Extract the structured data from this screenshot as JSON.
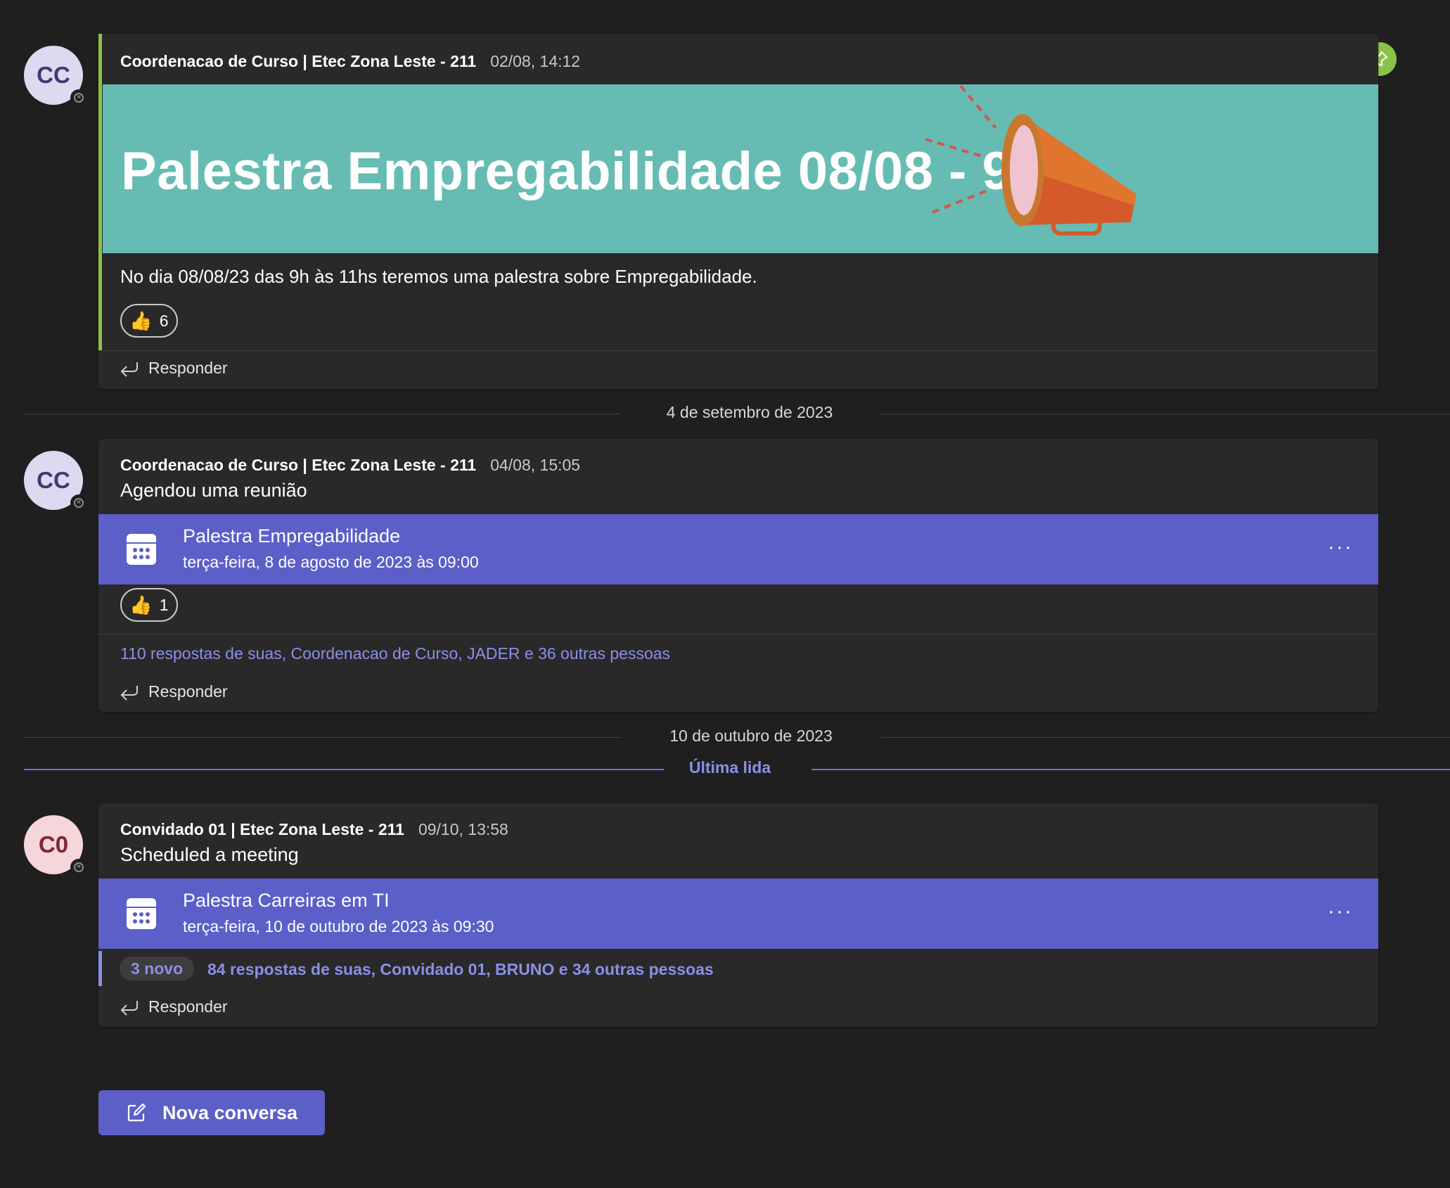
{
  "posts": [
    {
      "avatar_initials": "CC",
      "author": "Coordenacao de Curso | Etec Zona Leste - 211",
      "time": "02/08, 14:12",
      "banner_title": "Palestra Empregabilidade 08/08 - 9h",
      "body": "No dia 08/08/23 das 9h às 11hs teremos uma palestra sobre Empregabilidade.",
      "reaction_count": "6",
      "reply_label": "Responder"
    },
    {
      "avatar_initials": "CC",
      "author": "Coordenacao de Curso | Etec Zona Leste - 211",
      "time": "04/08, 15:05",
      "subject": "Agendou uma reunião",
      "meeting_title": "Palestra Empregabilidade",
      "meeting_date": "terça-feira, 8 de agosto de 2023 às 09:00",
      "reaction_count": "1",
      "replies_summary": "110 respostas de suas, Coordenacao de Curso, JADER e 36 outras pessoas",
      "reply_label": "Responder"
    },
    {
      "avatar_initials": "C0",
      "author": "Convidado 01 | Etec Zona Leste - 211",
      "time": "09/10, 13:58",
      "subject": "Scheduled a meeting",
      "meeting_title": "Palestra Carreiras em TI",
      "meeting_date": "terça-feira, 10 de outubro de 2023 às 09:30",
      "new_badge": "3 novo",
      "replies_summary": "84 respostas de suas, Convidado 01, BRUNO e 34 outras pessoas",
      "reply_label": "Responder"
    }
  ],
  "date_separators": [
    "4 de setembro de 2023",
    "10 de outubro de 2023"
  ],
  "last_read_label": "Última lida",
  "new_conversation_label": "Nova conversa",
  "icons": {
    "pin": "pin-icon",
    "calendar": "calendar-icon",
    "reply": "reply-icon",
    "compose": "compose-icon",
    "megaphone": "megaphone-icon",
    "thumbs_up": "thumbs-up-icon"
  },
  "colors": {
    "background": "#1f1f1f",
    "card": "#292929",
    "accent": "#5b5fc7",
    "link": "#8b8fe8",
    "banner": "#66bcb3",
    "pinned_accent": "#8bc34a"
  }
}
